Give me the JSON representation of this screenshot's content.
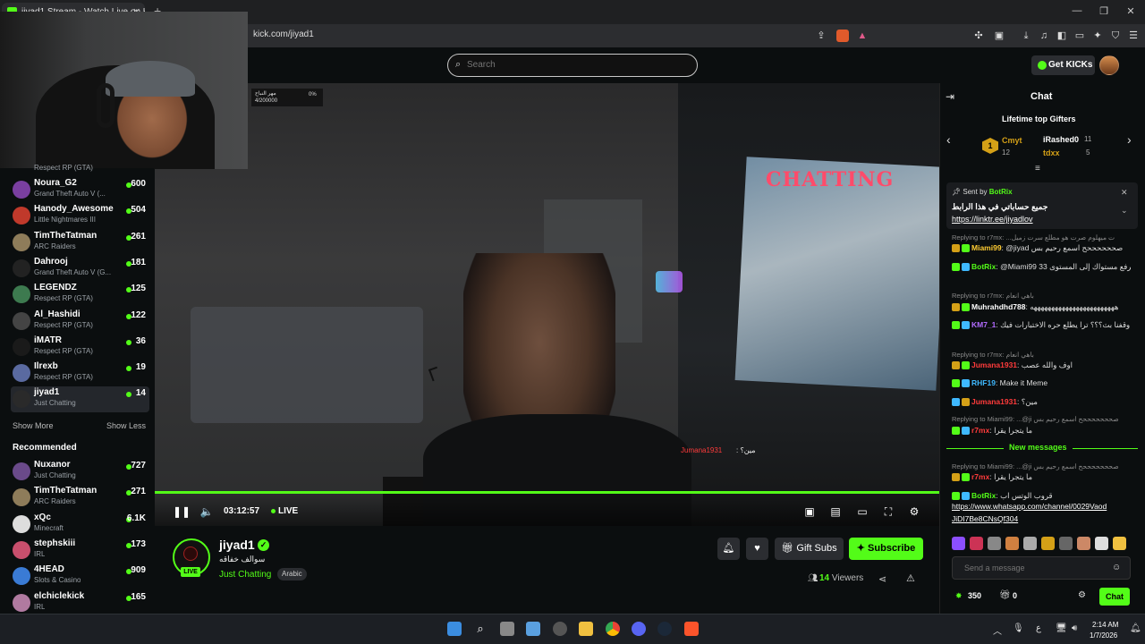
{
  "browser": {
    "tab_title": "jiyad1 Stream - Watch Live on K",
    "url": "kick.com/jiyad1"
  },
  "header": {
    "search_placeholder": "Search",
    "get_kicks": "Get KICKs"
  },
  "sidebar": {
    "cut_category": "Respect RP (GTA)",
    "following": [
      {
        "name": "Noura_G2",
        "category": "Grand Theft Auto V (...",
        "viewers": "600",
        "color": "#7a3fa0"
      },
      {
        "name": "Hanody_Awesome",
        "category": "Little Nightmares III",
        "viewers": "504",
        "color": "#c0392b"
      },
      {
        "name": "TimTheTatman",
        "category": "ARC Raiders",
        "viewers": "261",
        "color": "#8e7c5a"
      },
      {
        "name": "Dahrooj",
        "category": "Grand Theft Auto V (G...",
        "viewers": "181",
        "color": "#222222"
      },
      {
        "name": "LEGENDZ",
        "category": "Respect RP (GTA)",
        "viewers": "125",
        "color": "#3d7a4f"
      },
      {
        "name": "Al_Hashidi",
        "category": "Respect RP (GTA)",
        "viewers": "122",
        "color": "#444444"
      },
      {
        "name": "iMATR",
        "category": "Respect RP (GTA)",
        "viewers": "36",
        "color": "#1a1a1a"
      },
      {
        "name": "Ilrexb",
        "category": "Respect RP (GTA)",
        "viewers": "19",
        "color": "#5a6aa0"
      },
      {
        "name": "jiyad1",
        "category": "Just Chatting",
        "viewers": "14",
        "color": "#2a2a2a"
      }
    ],
    "show_more": "Show More",
    "show_less": "Show Less",
    "recommended_title": "Recommended",
    "recommended": [
      {
        "name": "Nuxanor",
        "category": "Just Chatting",
        "viewers": "727",
        "color": "#6a4a8a"
      },
      {
        "name": "TimTheTatman",
        "category": "ARC Raiders",
        "viewers": "271",
        "color": "#8e7c5a"
      },
      {
        "name": "xQc",
        "category": "Minecraft",
        "viewers": "6.1K",
        "color": "#dddddd"
      },
      {
        "name": "stephskiii",
        "category": "IRL",
        "viewers": "173",
        "color": "#c94f6d"
      },
      {
        "name": "4HEAD",
        "category": "Slots & Casino",
        "viewers": "909",
        "color": "#3a7bd5"
      },
      {
        "name": "elchiclekick",
        "category": "IRL",
        "viewers": "165",
        "color": "#b07aa0"
      }
    ]
  },
  "video": {
    "time": "03:12:57",
    "live": "LIVE",
    "overlay_top_text": "مهر النباح",
    "overlay_top_sub": "4/200000",
    "overlay_top_pct": "0%",
    "poster_text": "CHATTING",
    "overlay_chat_name": "Jumana1931",
    "overlay_chat_text": ": مين؟",
    "progress_percent": 100
  },
  "stream": {
    "streamer": "jiyad1",
    "title": "سوالف خفاقه",
    "category": "Just Chatting",
    "language": "Arabic",
    "live_badge": "LIVE",
    "gift_subs": "Gift Subs",
    "subscribe": "Subscribe",
    "viewers_count": "14",
    "viewers_label": "Viewers"
  },
  "chat": {
    "title": "Chat",
    "gifters_title": "Lifetime top Gifters",
    "gifters": [
      {
        "rank": "1",
        "name": "Cmyt",
        "count": "12"
      },
      {
        "name": "iRashed0",
        "count": "11"
      },
      {
        "name": "tdxx",
        "count": "5"
      }
    ],
    "pinned": {
      "sent_by": "Sent by",
      "sender": "BotRix",
      "text": "جميع حساباتي في هذا الرابط",
      "link": "https://linktr.ee/jiyadlov"
    },
    "messages": [
      {
        "type": "reply",
        "text": "Replying to r7mx: ...ت ميهلوم صرت هو مطلع سرت زميل"
      },
      {
        "type": "msg",
        "user": "Miami99",
        "user_color": "#ffcc33",
        "text": "@jiyad صححححححح اسمع رحيم بس"
      },
      {
        "type": "msg",
        "user": "BotRix",
        "user_color": "#53fc18",
        "text": "@Miami99 قمت برفع مستواك إلى المستوى 33"
      },
      {
        "type": "reply",
        "text": "Replying to r7mx: باهي انعام"
      },
      {
        "type": "msg",
        "user": "Muhrahdhd788",
        "user_color": "#ffffff",
        "text": "ههههههههههههههههههههههههه"
      },
      {
        "type": "msg",
        "user": "KM7_1",
        "user_color": "#b36bff",
        "text": "محد قالك تبث طقينك مع بيتك وقفنا بث؟؟؟ ترا يطلع حره الاختبارات فيك"
      },
      {
        "type": "reply",
        "text": "Replying to r7mx: باهي انعام"
      },
      {
        "type": "msg",
        "user": "Jumana1931",
        "user_color": "#ff3b3b",
        "text": "اوف والله عصب"
      },
      {
        "type": "msg",
        "user": "RHF19",
        "user_color": "#3fb9ff",
        "text": "Make it Meme"
      },
      {
        "type": "msg",
        "user": "Jumana1931",
        "user_color": "#ff3b3b",
        "text": "مين؟"
      },
      {
        "type": "reply",
        "text": "Replying to Miami99: ...@ji صحححححححح اسمع رحيم بس"
      },
      {
        "type": "msg",
        "user": "r7mx",
        "user_color": "#ff3b3b",
        "text": "ما يتجرا يقرا"
      }
    ],
    "new_messages": "New messages",
    "after": [
      {
        "type": "reply",
        "text": "Replying to Miami99: ...@ji صحححححححح اسمع رحيم بس"
      },
      {
        "type": "msg",
        "user": "r7mx",
        "user_color": "#ff3b3b",
        "text": "ما يتجرا يقرا"
      },
      {
        "type": "msg",
        "user": "BotRix",
        "user_color": "#53fc18",
        "text": "قروب الوتس اب"
      }
    ],
    "whatsapp_link_1": "https://www.whatsapp.com/channel/0029Vaod",
    "whatsapp_link_2": "JiDI7Be8CNsQf304",
    "input_placeholder": "Send a message",
    "points": "350",
    "gifts": "0",
    "send_label": "Chat"
  },
  "taskbar": {
    "time": "2:14 AM",
    "date": "1/7/2026",
    "lang": "ع"
  }
}
